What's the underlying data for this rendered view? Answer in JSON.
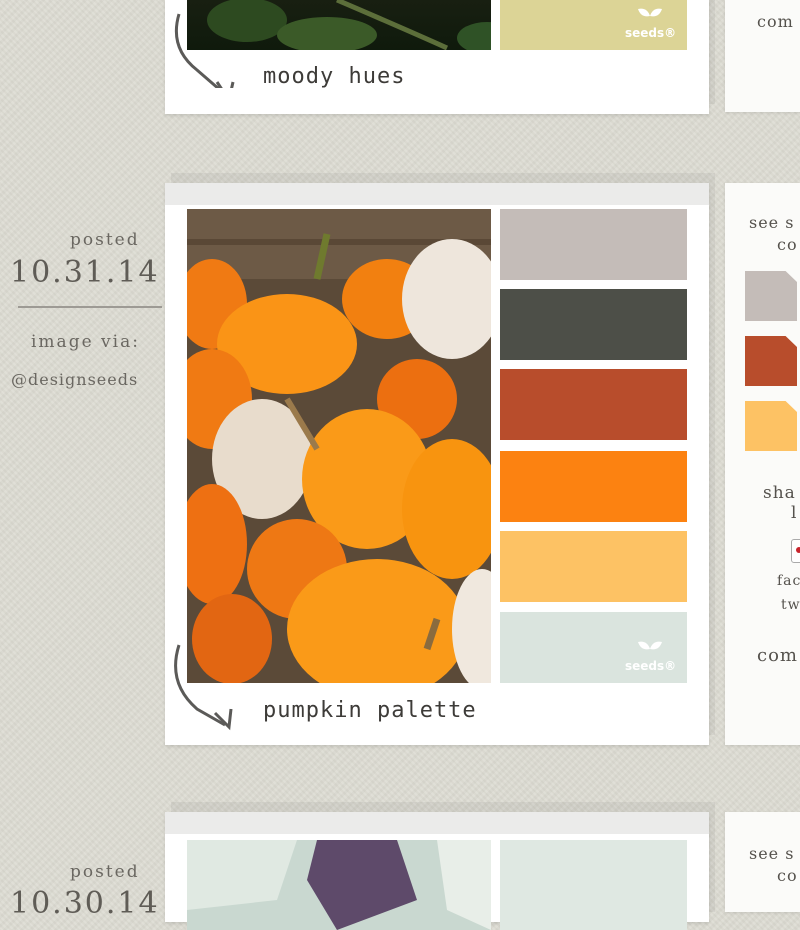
{
  "posts": [
    {
      "caption": "moody hues",
      "swatches": [
        "#dcd496"
      ],
      "logo_text": "seeds®"
    },
    {
      "date_label": "posted",
      "date": "10.31.14",
      "image_via_label": "image via:",
      "image_via_handle": "@designseeds",
      "caption": "pumpkin palette",
      "swatches": [
        "#c4bcb8",
        "#4d4f48",
        "#b84d2c",
        "#fc8211",
        "#fdc264",
        "#dae4de"
      ],
      "logo_text": "seeds®"
    },
    {
      "date_label": "posted",
      "date": "10.30.14",
      "swatches": [
        "#dfe8e2"
      ]
    }
  ],
  "side": {
    "comments_top": "com",
    "see_s": "see s",
    "co": "co",
    "chips": [
      "#c4bcb8",
      "#b84d2c",
      "#fdc264"
    ],
    "share": "sha",
    "l": "l",
    "fac": "fac",
    "tw": "tw",
    "comments": "com",
    "see_s_bottom": "see s",
    "co_bottom": "co"
  },
  "icons": [
    "seeds-leaf-icon",
    "curved-arrow-icon"
  ]
}
